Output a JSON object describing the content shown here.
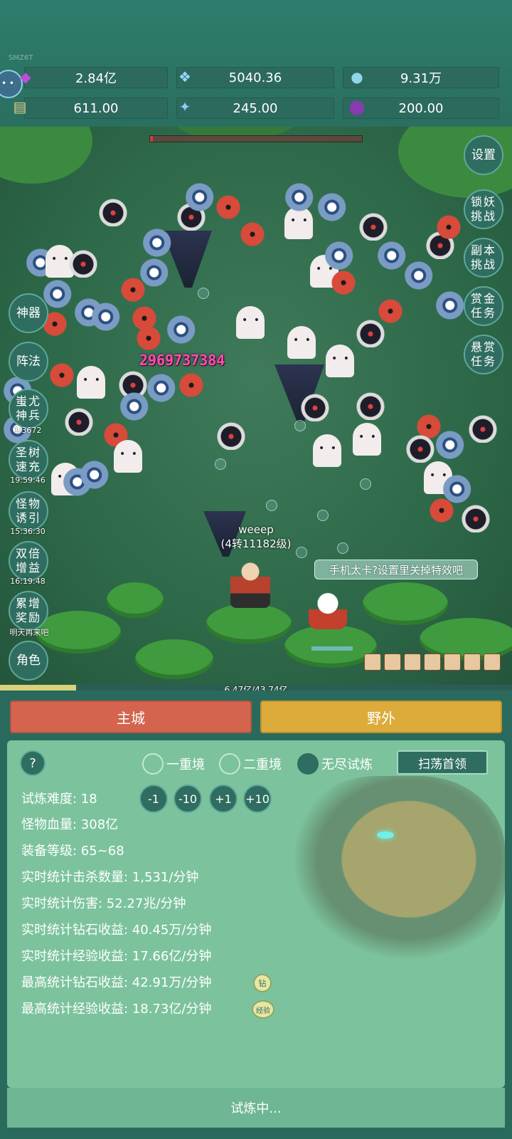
{
  "header": {
    "watermark": "SMZ6T",
    "resources": [
      {
        "icon": "purple-gem-icon",
        "value": "2.84亿"
      },
      {
        "icon": "blue-crystal-icon",
        "value": "5040.36"
      },
      {
        "icon": "orb-icon",
        "value": "9.31万"
      },
      {
        "icon": "scroll-icon",
        "value": "611.00"
      },
      {
        "icon": "ice-shard-icon",
        "value": "245.00"
      },
      {
        "icon": "potion-icon",
        "value": "200.00"
      }
    ]
  },
  "battle": {
    "damage_number": "2969737384",
    "player_name": "weeep",
    "player_level": "(4转11182级)",
    "performance_tip": "手机太卡?设置里关掉特效吧"
  },
  "right_buttons": [
    {
      "label": "设置"
    },
    {
      "label": "锁妖挑战"
    },
    {
      "label": "副本挑战"
    },
    {
      "label": "赏金任务"
    },
    {
      "label": "悬赏任务"
    }
  ],
  "left_buttons": [
    {
      "label": "神器",
      "sub": ""
    },
    {
      "label": "阵法",
      "sub": ""
    },
    {
      "label": "蚩尤神兵",
      "sub": "1/3672"
    },
    {
      "label": "圣树速充",
      "sub": "19:59:46"
    },
    {
      "label": "怪物诱引",
      "sub": "15:36:30"
    },
    {
      "label": "双倍增益",
      "sub": "16:19:48"
    },
    {
      "label": "累增奖励",
      "sub": "明天再来吧"
    },
    {
      "label": "角色",
      "sub": ""
    }
  ],
  "exp": {
    "text": "6.47亿/43.74亿",
    "progress": 0.148
  },
  "tabs": {
    "main_city": "主城",
    "wild": "野外"
  },
  "panel": {
    "help": "?",
    "modes": [
      {
        "label": "一重境",
        "selected": false
      },
      {
        "label": "二重境",
        "selected": false
      },
      {
        "label": "无尽试炼",
        "selected": true
      }
    ],
    "sweep_button": "扫荡首领",
    "difficulty": "试炼难度: 18",
    "adjust_buttons": [
      "-1",
      "-10",
      "+1",
      "+10"
    ],
    "monster_hp": "怪物血量: 308亿",
    "equip_level": "装备等级: 65~68",
    "kills": "实时统计击杀数量: 1,531/分钟",
    "damage": "实时统计伤害: 52.27兆/分钟",
    "diamond_income": "实时统计钻石收益: 40.45万/分钟",
    "exp_income": "实时统计经验收益: 17.66亿/分钟",
    "best_diamond": "最高统计钻石收益: 42.91万/分钟",
    "best_diamond_badge": "钻",
    "best_exp": "最高统计经验收益: 18.73亿/分钟",
    "best_exp_badge": "经验"
  },
  "status": "试炼中...",
  "colors": {
    "main_city_tab": "#d4644e",
    "wild_tab": "#dcab3a",
    "panel": "#7cc39d",
    "button": "#2f6d61"
  }
}
